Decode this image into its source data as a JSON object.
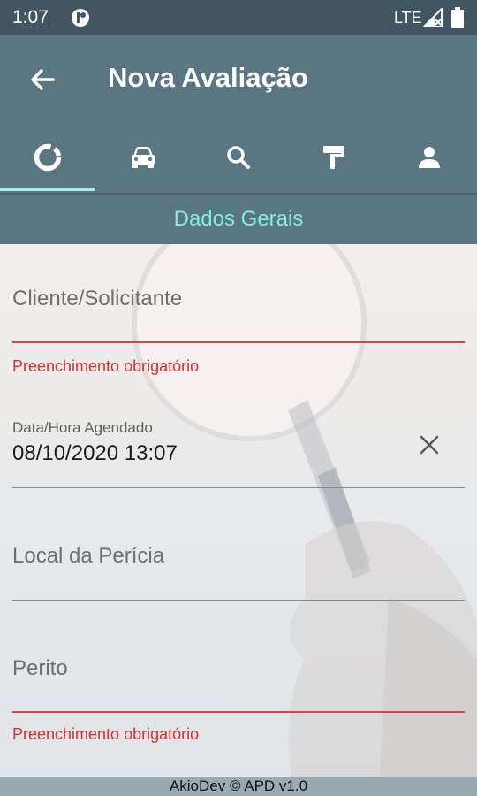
{
  "status_bar": {
    "time": "1:07",
    "network": "LTE",
    "icons": [
      "app-notification-icon",
      "signal-icon",
      "battery-icon"
    ]
  },
  "app_bar": {
    "title": "Nova Avaliação",
    "back_icon": "arrow-back-icon"
  },
  "tabs": [
    {
      "icon": "donut-progress-icon",
      "selected": true
    },
    {
      "icon": "car-icon",
      "selected": false
    },
    {
      "icon": "search-icon",
      "selected": false
    },
    {
      "icon": "paint-roller-icon",
      "selected": false
    },
    {
      "icon": "person-icon",
      "selected": false
    }
  ],
  "section": {
    "title": "Dados Gerais"
  },
  "form": {
    "cliente": {
      "placeholder": "Cliente/Solicitante",
      "error": "Preenchimento obrigatório"
    },
    "data_hora": {
      "label": "Data/Hora Agendado",
      "value": "08/10/2020 13:07",
      "clear_icon": "close-icon"
    },
    "local": {
      "placeholder": "Local da Perícia"
    },
    "perito": {
      "placeholder": "Perito",
      "error": "Preenchimento obrigatório"
    }
  },
  "footer": {
    "text": "AkioDev © APD v1.0"
  },
  "colors": {
    "status_bar": "#415660",
    "app_bar": "#5a7683",
    "accent": "#7ff0da",
    "error": "#d62f2f"
  }
}
